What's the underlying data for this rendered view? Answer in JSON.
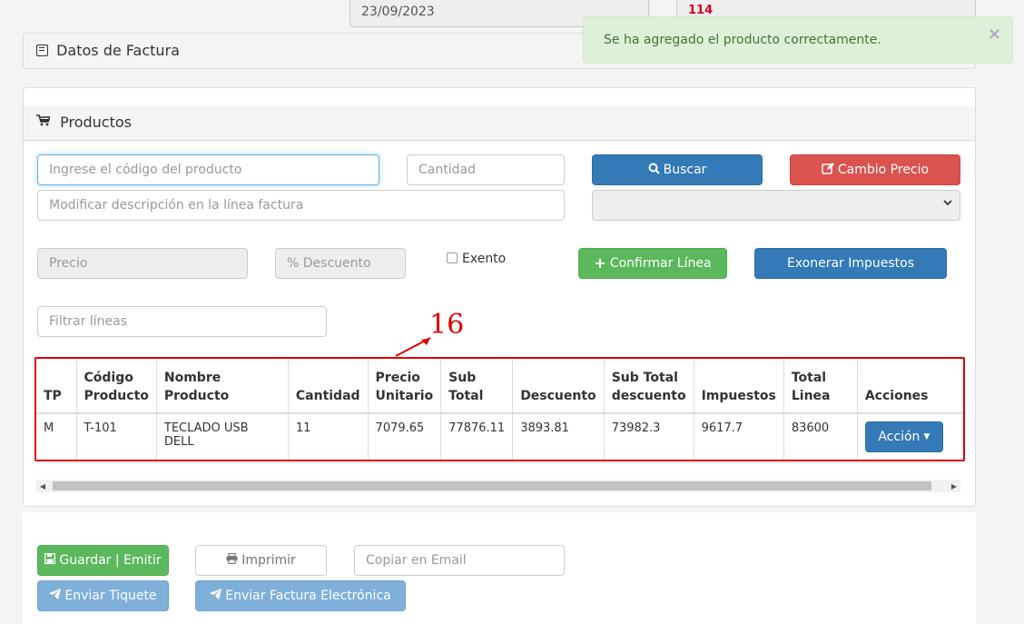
{
  "top": {
    "date": "23/09/2023",
    "number": "114"
  },
  "alert": {
    "message": "Se ha agregado el producto correctamente.",
    "close": "×"
  },
  "invoice_panel": {
    "title": "Datos de Factura"
  },
  "products_panel": {
    "title": "Productos",
    "code_placeholder": "Ingrese el código del producto",
    "qty_placeholder": "Cantidad",
    "desc_placeholder": "Modificar descripción en la línea factura",
    "price_placeholder": "Precio",
    "discount_placeholder": "% Descuento",
    "exento_label": "Exento",
    "filter_placeholder": "Filtrar líneas",
    "buttons": {
      "search": "Buscar",
      "price_change": "Cambio Precio",
      "confirm_line": "Confirmar Línea",
      "exonerate": "Exonerar Impuestos"
    }
  },
  "annotation": {
    "number": "16"
  },
  "table": {
    "headers": [
      "TP",
      "Código Producto",
      "Nombre Producto",
      "Cantidad",
      "Precio Unitario",
      "Sub Total",
      "Descuento",
      "Sub Total descuento",
      "Impuestos",
      "Total Linea",
      "Acciones"
    ],
    "rows": [
      [
        "M",
        "T-101",
        "TECLADO USB DELL",
        "11",
        "7079.65",
        "77876.11",
        "3893.81",
        "73982.3",
        "9617.7",
        "83600",
        "Acción"
      ]
    ]
  },
  "footer": {
    "save": "Guardar | Emitir",
    "print": "Imprimir",
    "email_placeholder": "Copiar en Email",
    "send_ticket": "Enviar Tiquete",
    "send_invoice": "Enviar Factura Electrónica"
  },
  "colors": {
    "primary": "#337ab7",
    "danger": "#d9534f",
    "success": "#5cb85c",
    "alert_bg": "#dff0d8",
    "annotation_red": "#e00000"
  }
}
